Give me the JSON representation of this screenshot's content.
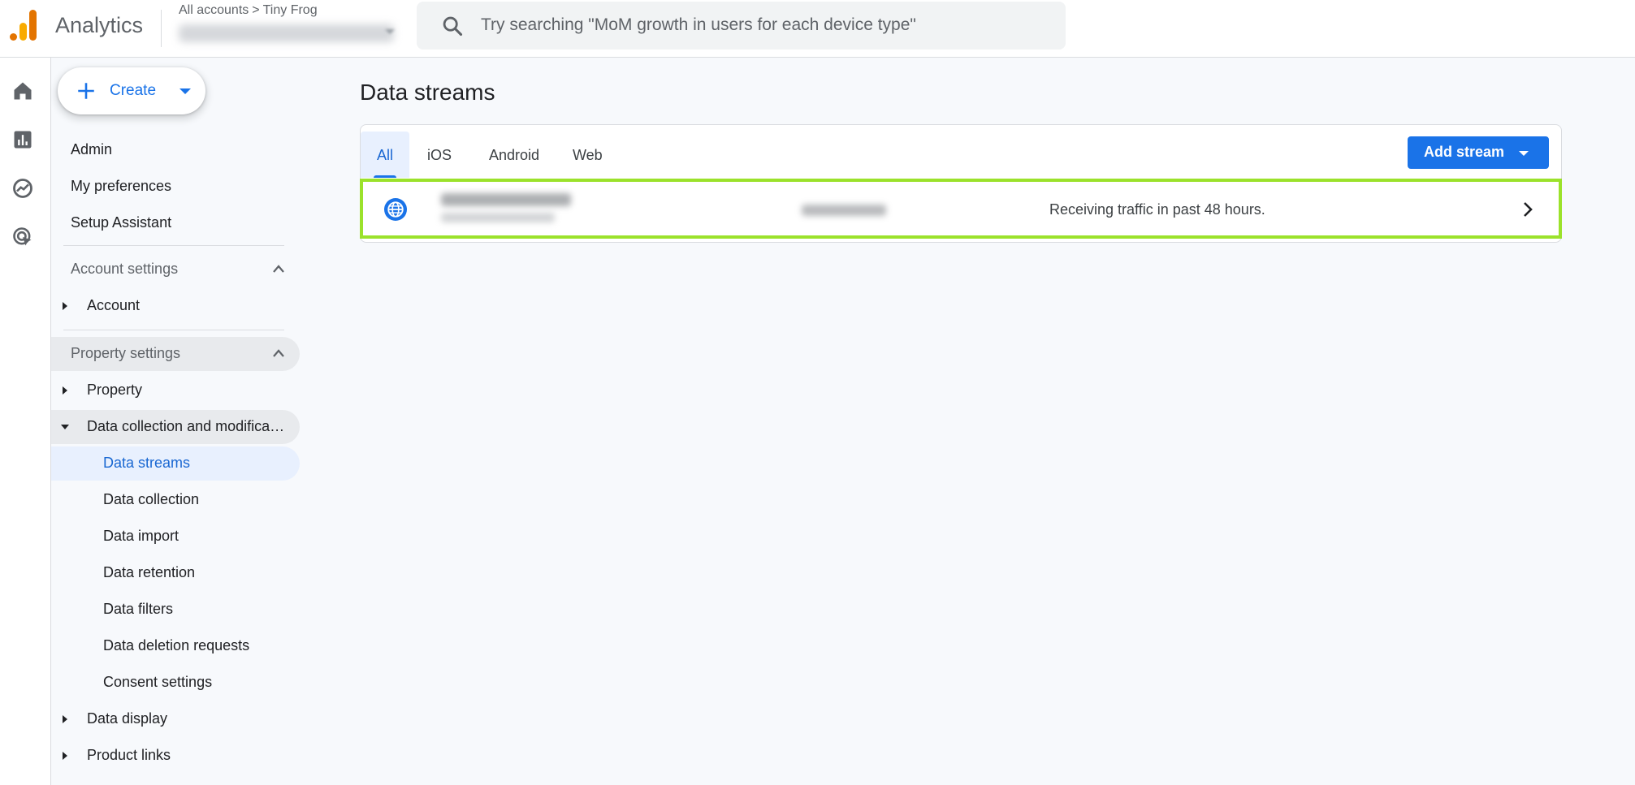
{
  "app": {
    "name": "Analytics",
    "breadcrumb": {
      "all_accounts": "All accounts",
      "separator": ">",
      "account": "Tiny Frog"
    }
  },
  "search": {
    "placeholder": "Try searching \"MoM growth in users for each device type\""
  },
  "rail": {
    "items": [
      "home-icon",
      "reports-icon",
      "explore-icon",
      "advertising-icon"
    ]
  },
  "sidebar": {
    "create_label": "Create",
    "top_items": [
      "Admin",
      "My preferences",
      "Setup Assistant"
    ],
    "account_settings": {
      "label": "Account settings",
      "items": [
        "Account"
      ]
    },
    "property_settings": {
      "label": "Property settings",
      "property": "Property",
      "data_collection": "Data collection and modifica…",
      "sub_items": [
        "Data streams",
        "Data collection",
        "Data import",
        "Data retention",
        "Data filters",
        "Data deletion requests",
        "Consent settings"
      ],
      "data_display": "Data display",
      "product_links": "Product links"
    }
  },
  "main": {
    "title": "Data streams",
    "tabs": [
      "All",
      "iOS",
      "Android",
      "Web"
    ],
    "active_tab": "All",
    "add_stream_label": "Add stream",
    "stream": {
      "status": "Receiving traffic in past 48 hours."
    }
  },
  "colors": {
    "accent": "#1a73e8",
    "highlight_border": "#9be22b",
    "logo_orange": "#e37400",
    "logo_yellow": "#f9ab00"
  }
}
